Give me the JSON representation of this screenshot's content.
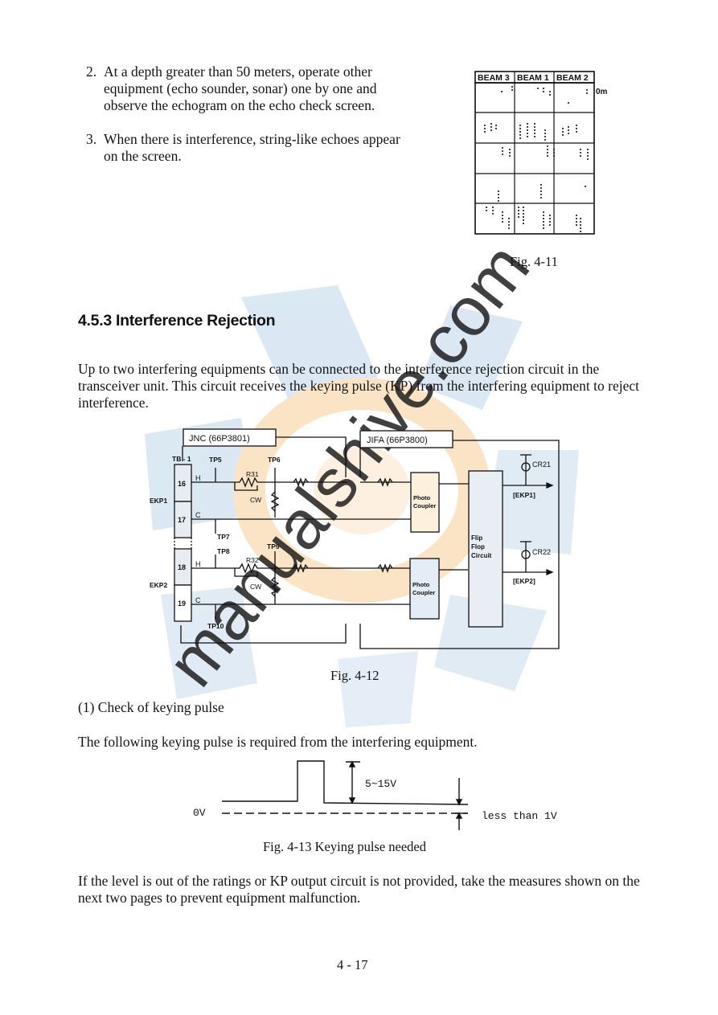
{
  "page": {
    "list_items": [
      {
        "number": "2.",
        "text": "At a depth greater than 50 meters, operate other equipment (echo sounder, sonar) one by one and observe the echogram on the echo check screen."
      },
      {
        "number": "3.",
        "text": "When there is interference, string-like echoes appear on the screen."
      }
    ],
    "fig_4_11": {
      "beams": [
        "BEAM 3",
        "BEAM 1",
        "BEAM 2"
      ],
      "depth_label": "0m",
      "caption": "Fig. 4-11"
    },
    "section_heading": "4.5.3 Interference Rejection",
    "intro_paragraph": "Up to two interfering equipments can be connected to the interference rejection circuit in the transceiver unit. This circuit receives the keying pulse (KP) from the interfering equipment to reject interference.",
    "fig_4_12": {
      "jnc_label": "JNC (66P3801)",
      "jifa_label": "JIFA (66P3800)",
      "tb_label": "TB - 1",
      "terminals": [
        "16",
        "17",
        "18",
        "19"
      ],
      "ekp_inputs": [
        "EKP1",
        "EKP2"
      ],
      "hot_label": "H",
      "common_label": "C",
      "test_points": [
        "TP5",
        "TP6",
        "TP7",
        "TP8",
        "TP9",
        "TP10"
      ],
      "resistors": [
        "R31",
        "R32"
      ],
      "cw_label": "CW",
      "photo_coupler_label": [
        "Photo",
        "Coupler"
      ],
      "flip_flop_label": [
        "Flip",
        "Flop",
        "Circuit"
      ],
      "leds": [
        "CR21",
        "CR22"
      ],
      "outputs": [
        "[EKP1]",
        "[EKP2]"
      ],
      "caption": "Fig. 4-12"
    },
    "subsection": "(1) Check of keying pulse",
    "keying_requirement": "The following keying pulse is required from the interfering equipment.",
    "fig_4_13": {
      "amplitude_label": "5~15V",
      "zero_label": "0V",
      "offset_label": "less than 1V",
      "caption": "Fig. 4-13 Keying pulse needed"
    },
    "closing_paragraph": "If the level is out of the ratings or KP output circuit is not provided, take the measures shown on the next two pages to prevent equipment malfunction.",
    "page_number": "4 - 17"
  },
  "colors": {
    "watermark_blue": "#cfe0ee",
    "watermark_orange": "#fbe3c3",
    "watermark_text": "#c9c9f2",
    "ink": "#111111"
  }
}
